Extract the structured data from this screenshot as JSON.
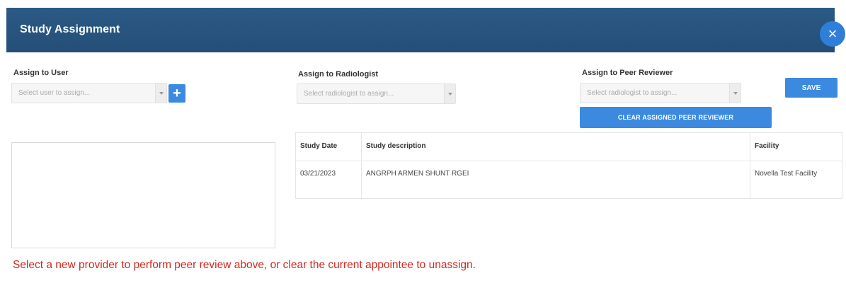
{
  "dialog": {
    "title": "Study Assignment",
    "close_label": "×",
    "save_label": "SAVE"
  },
  "assign_user": {
    "label": "Assign to User",
    "placeholder": "Select user to assign...",
    "add_label": "+"
  },
  "assign_radiologist": {
    "label": "Assign to Radiologist",
    "placeholder": "Select radiologist to assign..."
  },
  "assign_peer": {
    "label": "Assign to Peer Reviewer",
    "placeholder": "Select radiologist to assign...",
    "clear_label": "CLEAR ASSIGNED PEER REVIEWER"
  },
  "table": {
    "headers": [
      "Study Date",
      "Study description",
      "Facility"
    ],
    "rows": [
      [
        "03/21/2023",
        "ANGRPH ARMEN SHUNT RGEI",
        "Novella Test Facility"
      ]
    ]
  },
  "message": "Select a new provider to perform peer review above, or clear the current appointee to unassign."
}
